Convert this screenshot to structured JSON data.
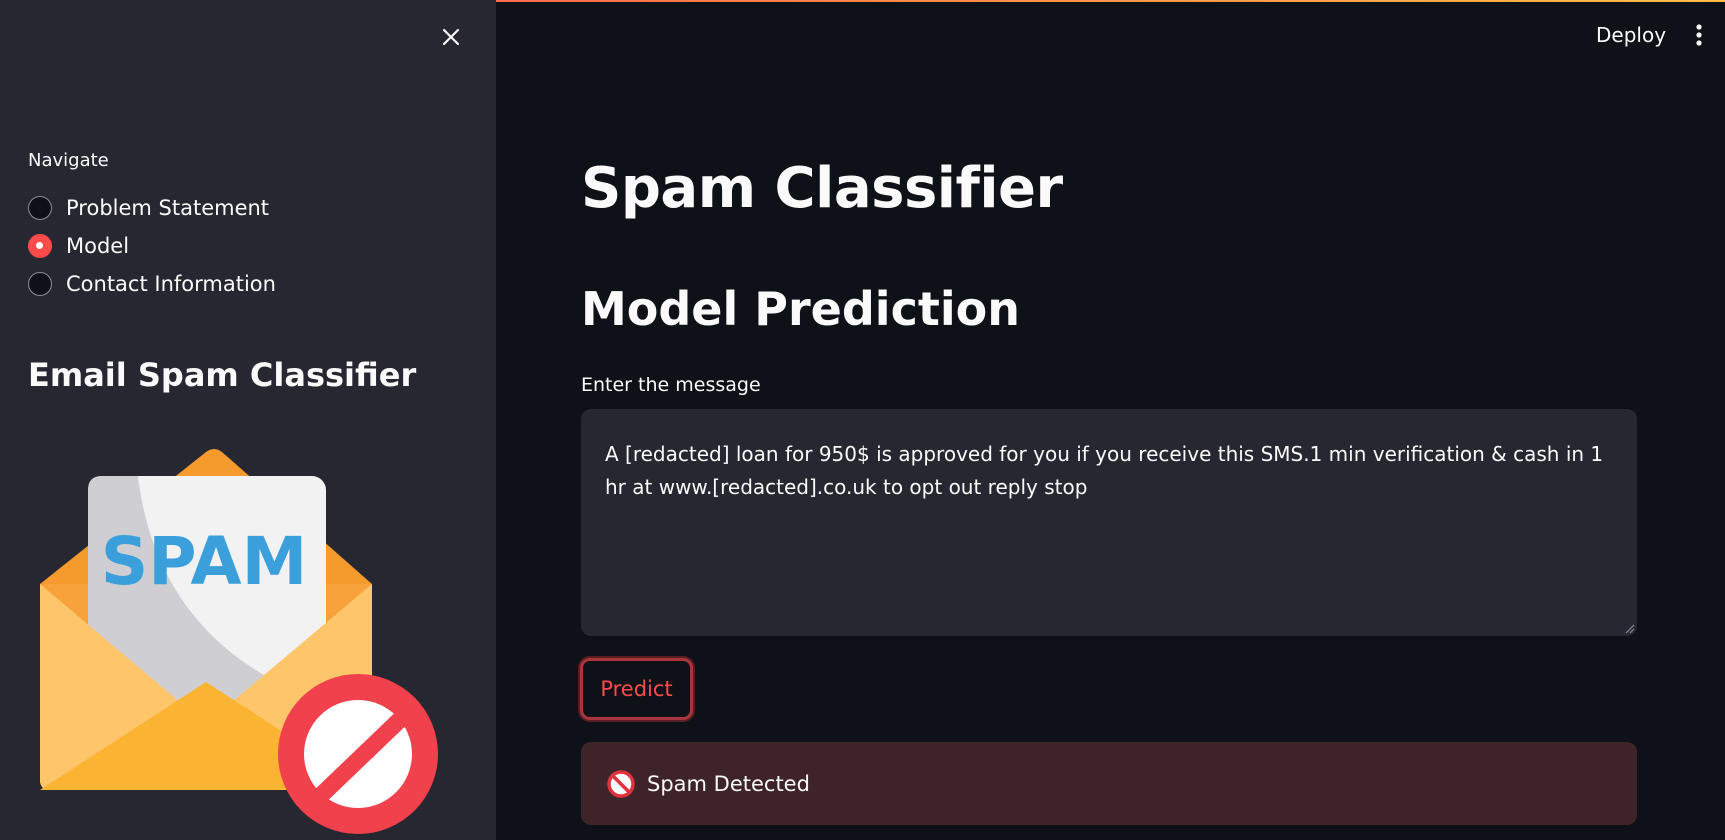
{
  "sidebar": {
    "nav_label": "Navigate",
    "options": [
      {
        "label": "Problem Statement",
        "selected": false
      },
      {
        "label": "Model",
        "selected": true
      },
      {
        "label": "Contact Information",
        "selected": false
      }
    ],
    "heading": "Email Spam Classifier",
    "illustration_text": "SPAM"
  },
  "header": {
    "deploy_label": "Deploy"
  },
  "main": {
    "title": "Spam Classifier",
    "section_title": "Model Prediction",
    "input_label": "Enter the message",
    "message_value": "A [redacted] loan for 950$ is approved for you if you receive this SMS.1 min verification & cash in 1 hr at www.[redacted].co.uk to opt out reply stop",
    "predict_label": "Predict",
    "result_text": "Spam Detected"
  },
  "colors": {
    "accent": "#ff4b4b",
    "sidebar_bg": "#262730",
    "main_bg": "#0e1117",
    "error_bg": "#3e2428"
  }
}
